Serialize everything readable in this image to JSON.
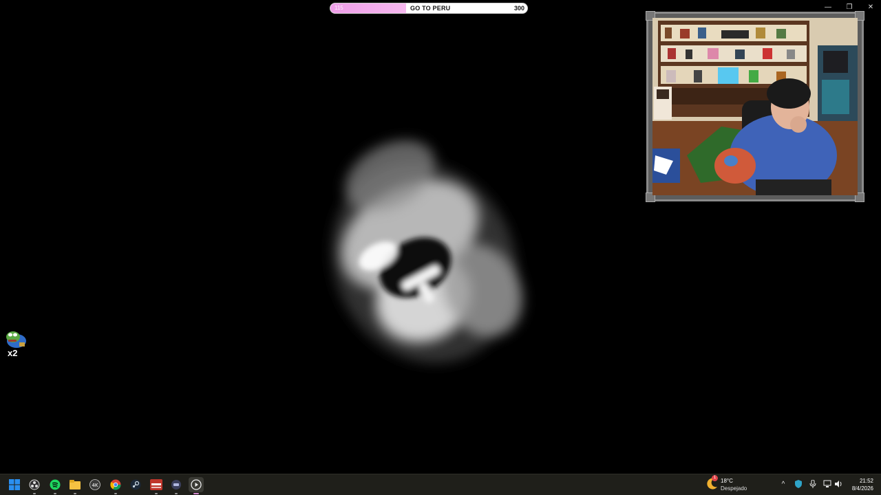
{
  "goal": {
    "current": "115",
    "label": "GO TO PERU",
    "target": "300",
    "progress": 0.383
  },
  "window_controls": {
    "minimize": "—",
    "restore": "❐",
    "close": "✕"
  },
  "emote": {
    "count": "x2",
    "icon": "pepe-emote-icon"
  },
  "taskbar": {
    "apps": [
      {
        "name": "start-menu-icon"
      },
      {
        "name": "obs-icon"
      },
      {
        "name": "spotify-icon"
      },
      {
        "name": "file-explorer-icon"
      },
      {
        "name": "4k-downloader-icon"
      },
      {
        "name": "chrome-icon"
      },
      {
        "name": "steam-icon"
      },
      {
        "name": "rockstar-launcher-icon"
      },
      {
        "name": "app-icon"
      },
      {
        "name": "media-player-icon"
      }
    ],
    "weather": {
      "temp": "18°C",
      "desc": "Despejado",
      "badge": "1"
    },
    "clock": {
      "time": "21:52",
      "date": "8/4/2026"
    }
  },
  "colors": {
    "goal_fill": "#f0a8ea",
    "taskbar_bg": "#1f1f1a",
    "frame": "#7a7a7a"
  }
}
